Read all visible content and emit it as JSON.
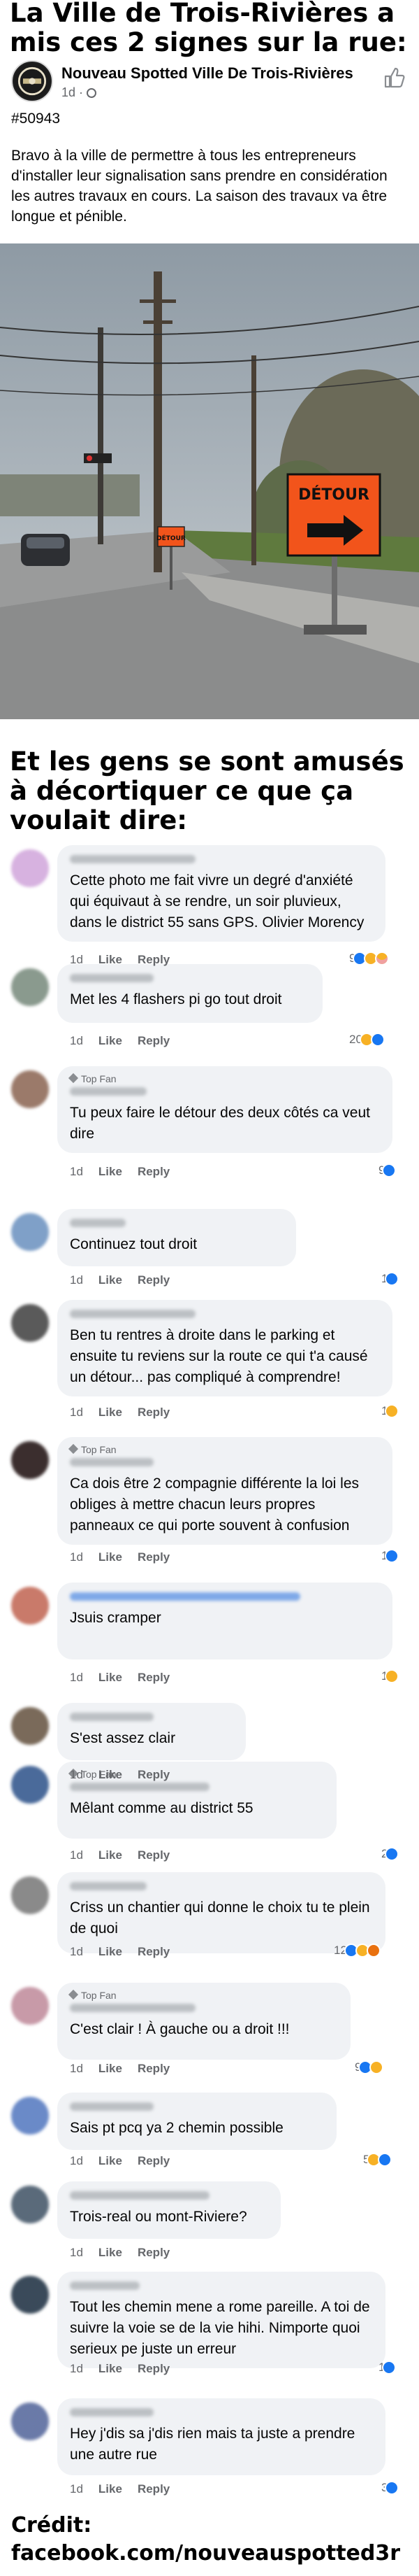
{
  "headline_top": "La Ville de Trois-Rivières a mis ces 2 signes sur la rue:",
  "post": {
    "page_name": "Nouveau Spotted Ville De Trois-Rivières",
    "meta": "1d · ",
    "tag": "#50943",
    "body": "Bravo à la ville de permettre à tous les entrepreneurs d'installer leur signalisation sans prendre en considération les autres travaux en cours. La saison des travaux va être longue et pénible.",
    "sign_small": "DÉTOUR",
    "sign_big": "DÉTOUR"
  },
  "headline_mid": "Et les gens se sont amusés à décortiquer ce que ça voulait dire:",
  "labels": {
    "like": "Like",
    "reply": "Reply",
    "top_fan": "Top Fan"
  },
  "comments": [
    {
      "age": "1d",
      "text": "Cette photo me fait vivre un degré d'anxiété qui équivaut à se rendre, un soir pluvieux, dans le district 55 sans GPS. Olivier Morency",
      "count": "9",
      "reactions": [
        "like",
        "haha",
        "care"
      ]
    },
    {
      "age": "1d",
      "text": "Met les 4 flashers pi go tout droit",
      "count": "20",
      "reactions": [
        "haha",
        "like"
      ]
    },
    {
      "age": "1d",
      "text": "Tu peux faire le détour des deux côtés ca veut dire",
      "count": "9",
      "reactions": [
        "like"
      ]
    },
    {
      "age": "1d",
      "text": "Continuez tout droit",
      "count": "1",
      "reactions": [
        "like"
      ]
    },
    {
      "age": "1d",
      "text": "Ben tu rentres à droite dans le parking et ensuite tu reviens sur la route ce qui t'a causé un détour... pas compliqué à comprendre!",
      "count": "1",
      "reactions": [
        "haha"
      ]
    },
    {
      "age": "1d",
      "text": "Ca dois être 2 compagnie différente la loi les obliges à mettre chacun leurs propres panneaux ce qui porte souvent à confusion",
      "count": "1",
      "reactions": [
        "like"
      ]
    },
    {
      "age": "1d",
      "text": "Jsuis cramper",
      "count": "1",
      "reactions": [
        "haha"
      ]
    },
    {
      "age": "1d",
      "text": "S'est assez clair"
    },
    {
      "age": "1d",
      "text": "Mêlant comme au district 55",
      "count": "2",
      "reactions": [
        "like"
      ]
    },
    {
      "age": "1d",
      "text": "Criss un chantier qui donne le choix tu te plein de quoi",
      "count": "12",
      "reactions": [
        "like",
        "haha",
        "angry"
      ]
    },
    {
      "age": "1d",
      "text": "C'est clair ! À gauche ou a droit !!!",
      "count": "9",
      "reactions": [
        "like",
        "haha"
      ]
    },
    {
      "age": "1d",
      "text": "Sais pt pcq ya 2 chemin possible",
      "count": "5",
      "reactions": [
        "haha",
        "like"
      ]
    },
    {
      "age": "1d",
      "text": "Trois-real ou mont-Riviere?"
    },
    {
      "age": "1d",
      "text": "Tout les chemin mene a rome pareille. A toi de suivre la voie se de la vie hihi.  Nimporte quoi serieux pe juste un erreur",
      "count": "1",
      "reactions": [
        "like"
      ]
    },
    {
      "age": "1d",
      "text": "Hey j'dis sa j'dis rien mais ta juste a prendre une autre rue",
      "count": "3",
      "reactions": [
        "like"
      ]
    }
  ],
  "credit_label": "Crédit:",
  "credit_url": "facebook.com/nouveauspotted3r"
}
